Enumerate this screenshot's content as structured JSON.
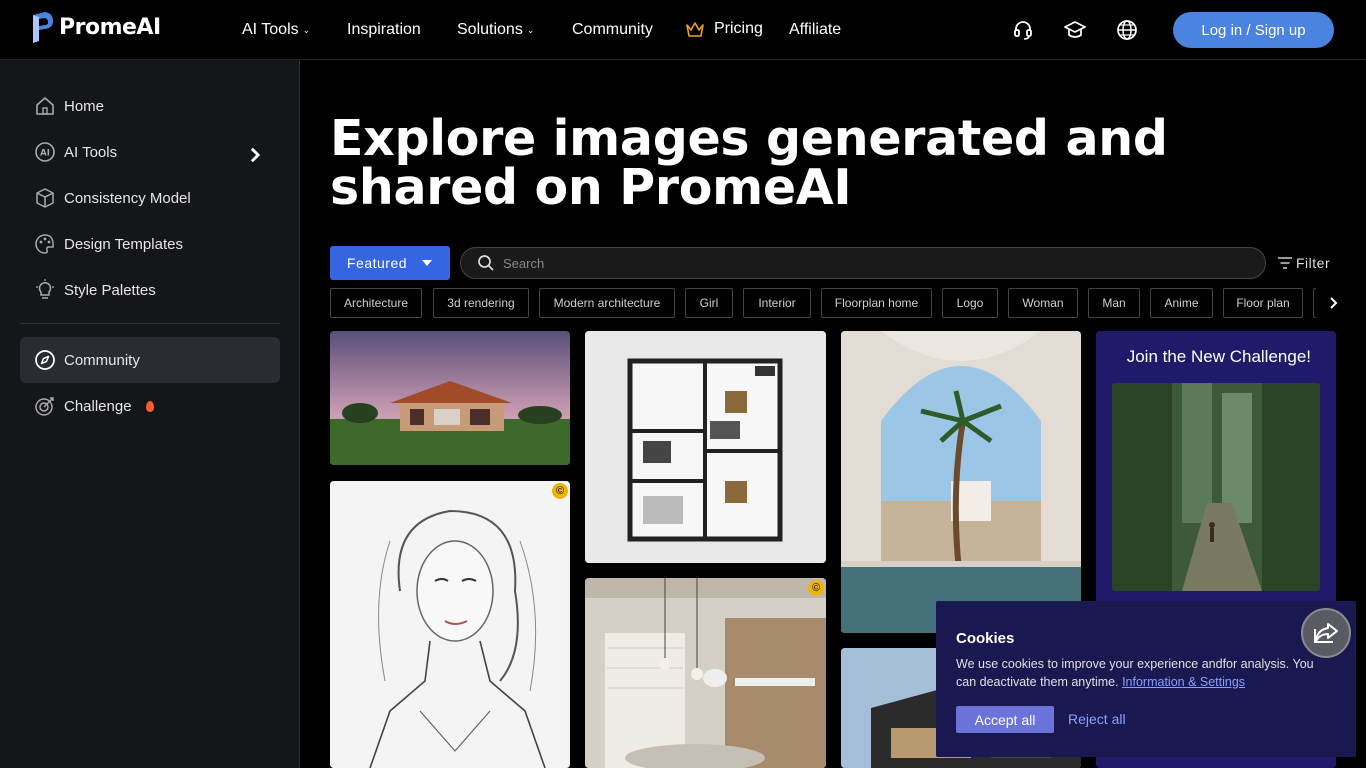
{
  "brand": {
    "name": "PromeAI",
    "accent": "#4b83e0"
  },
  "nav": {
    "items": [
      {
        "label": "AI Tools",
        "has_dropdown": true
      },
      {
        "label": "Inspiration",
        "has_dropdown": false
      },
      {
        "label": "Solutions",
        "has_dropdown": true
      },
      {
        "label": "Community",
        "has_dropdown": false
      },
      {
        "label": "Pricing",
        "icon": "crown-icon"
      },
      {
        "label": "Affiliate",
        "has_dropdown": false
      }
    ],
    "icons": [
      "headset-icon",
      "graduation-cap-icon",
      "globe-icon"
    ],
    "login_label": "Log in / Sign up"
  },
  "sidebar": {
    "items": [
      {
        "label": "Home",
        "icon": "home-icon"
      },
      {
        "label": "AI Tools",
        "icon": "ai-icon"
      },
      {
        "label": "Consistency Model",
        "icon": "cube-icon"
      },
      {
        "label": "Design Templates",
        "icon": "palette-icon"
      },
      {
        "label": "Style Palettes",
        "icon": "lightbulb-icon"
      },
      {
        "label": "Community",
        "icon": "compass-icon",
        "active": true
      },
      {
        "label": "Challenge",
        "icon": "target-icon",
        "badge": "flame-icon"
      }
    ]
  },
  "main": {
    "headline": "Explore images generated and shared on PromeAI",
    "sort": {
      "selected": "Featured"
    },
    "search": {
      "placeholder": "Search"
    },
    "filter_label": "Filter",
    "tags": [
      "Architecture",
      "3d rendering",
      "Modern architecture",
      "Girl",
      "Interior",
      "Floorplan home",
      "Logo",
      "Woman",
      "Man",
      "Anime",
      "Floor plan"
    ],
    "challenge": {
      "title": "Join the New Challenge!"
    }
  },
  "cookie": {
    "title": "Cookies",
    "text": "We use cookies to improve your experience andfor analysis. You can deactivate them anytime.",
    "link": "Information & Settings",
    "accept": "Accept all",
    "reject": "Reject all"
  }
}
